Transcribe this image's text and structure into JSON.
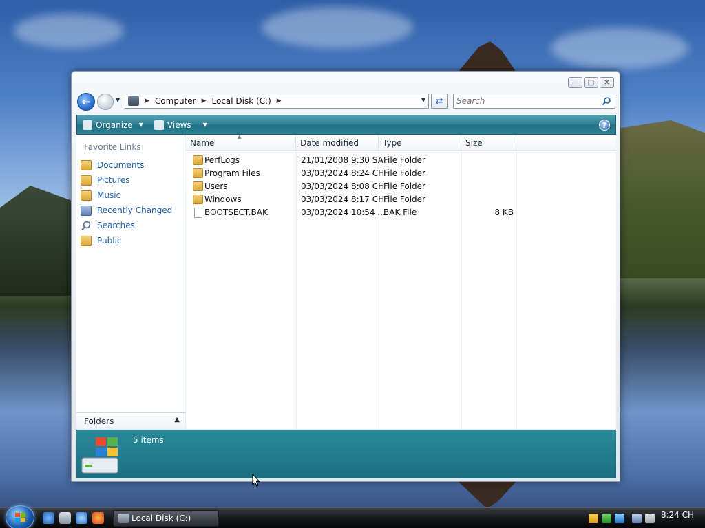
{
  "window": {
    "address": {
      "crumbs": [
        "Computer",
        "Local Disk (C:)"
      ]
    },
    "search": {
      "placeholder": "Search"
    },
    "toolbar": {
      "organize_label": "Organize",
      "views_label": "Views"
    },
    "favorites": {
      "title": "Favorite Links",
      "items": [
        "Documents",
        "Pictures",
        "Music",
        "Recently Changed",
        "Searches",
        "Public"
      ]
    },
    "folders_label": "Folders",
    "columns": [
      "Name",
      "Date modified",
      "Type",
      "Size"
    ],
    "files": [
      {
        "name": "PerfLogs",
        "date": "21/01/2008 9:30 SA",
        "type": "File Folder",
        "size": ""
      },
      {
        "name": "Program Files",
        "date": "03/03/2024 8:24 CH",
        "type": "File Folder",
        "size": ""
      },
      {
        "name": "Users",
        "date": "03/03/2024 8:08 CH",
        "type": "File Folder",
        "size": ""
      },
      {
        "name": "Windows",
        "date": "03/03/2024 8:17 CH",
        "type": "File Folder",
        "size": ""
      },
      {
        "name": "BOOTSECT.BAK",
        "date": "03/03/2024 10:54 ...",
        "type": "BAK File",
        "size": "8 KB"
      }
    ],
    "details": {
      "items_count": "5 items"
    }
  },
  "taskbar": {
    "task_label": "Local Disk (C:)",
    "clock": "8:24 CH"
  }
}
